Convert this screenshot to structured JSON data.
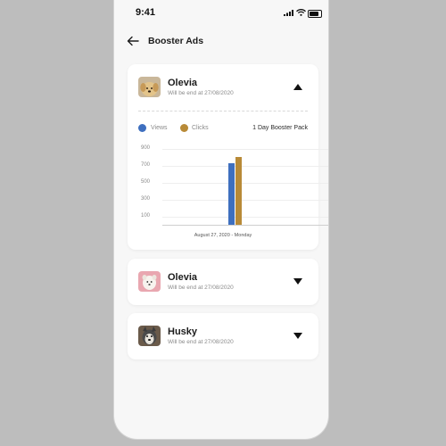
{
  "status": {
    "time": "9:41"
  },
  "header": {
    "title": "Booster Ads"
  },
  "ads": [
    {
      "name": "Olevia",
      "subtitle": "Will be end at 27/08/2020",
      "expanded": true,
      "avatar": "golden-puppy"
    },
    {
      "name": "Olevia",
      "subtitle": "Will be end at 27/08/2020",
      "expanded": false,
      "avatar": "white-puppy"
    },
    {
      "name": "Husky",
      "subtitle": "Will be end at 27/08/2020",
      "expanded": false,
      "avatar": "husky-dog"
    }
  ],
  "chart_labels": {
    "views": "Views",
    "clicks": "Clicks",
    "pack": "1 Day Booster Pack",
    "date": "August 27, 2020 - Monday"
  },
  "chart_data": {
    "type": "bar",
    "categories": [
      "August 27, 2020 - Monday"
    ],
    "series": [
      {
        "name": "Views",
        "values": [
          730
        ],
        "color": "#3e6fbf"
      },
      {
        "name": "Clicks",
        "values": [
          810
        ],
        "color": "#b88a37"
      }
    ],
    "yticks": [
      "900",
      "700",
      "500",
      "300",
      "100"
    ],
    "ylim": [
      0,
      900
    ],
    "grid": true,
    "legend": "top-left"
  }
}
